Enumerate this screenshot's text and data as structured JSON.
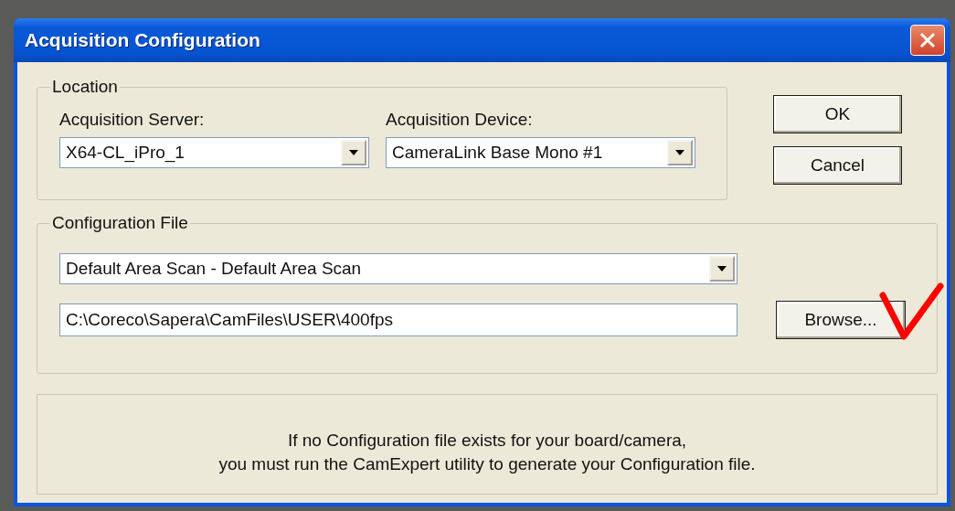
{
  "window": {
    "title": "Acquisition Configuration"
  },
  "location": {
    "legend": "Location",
    "fields": [
      {
        "label": "Acquisition Server:",
        "value": "X64-CL_iPro_1"
      },
      {
        "label": "Acquisition Device:",
        "value": "CameraLink Base Mono #1"
      }
    ]
  },
  "buttons": [
    {
      "label": "OK"
    },
    {
      "label": "Cancel"
    }
  ],
  "configuration_file": {
    "legend": "Configuration File",
    "preset": "Default Area Scan - Default Area Scan",
    "path": "C:\\Coreco\\Sapera\\CamFiles\\USER\\400fps",
    "browse_button": "Browse..."
  },
  "info": {
    "lines": [
      "If no Configuration file exists for your board/camera,",
      "you must run the CamExpert utility to generate your Configuration file."
    ]
  }
}
